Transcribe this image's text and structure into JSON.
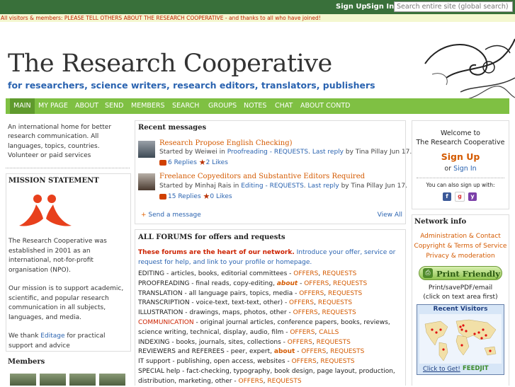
{
  "topbar": {
    "sign_up": "Sign Up",
    "sign_in": "Sign In",
    "search_placeholder": "Search entire site (global search)"
  },
  "notice": "All visitors & members: PLEASE TELL OTHERS ABOUT THE RESEARCH COOPERATIVE - and thanks to all who have joined!",
  "site": {
    "title": "The Research Cooperative",
    "subtitle": "for researchers, science writers, research editors, translators, publishers"
  },
  "nav": [
    "MAIN",
    "MY PAGE",
    "ABOUT",
    "SEND",
    "MEMBERS",
    "SEARCH",
    "GROUPS",
    "NOTES",
    "CHAT",
    "ABOUT CONTD"
  ],
  "left": {
    "intro": "An international home for better research communication. All languages, topics, countries. Volunteer or paid services",
    "mission_title": "MISSION STATEMENT",
    "mission_p1": "The Research Cooperative was established in 2001 as an international, not-for-profit organisation (NPO).",
    "mission_p2": "Our mission is to support academic, scientific, and popular research communication in all subjects, languages, and media.",
    "thanks_pre": "We thank ",
    "thanks_link": "Editage",
    "thanks_post": " for practical support and advice",
    "members_title": "Members"
  },
  "recent": {
    "title": "Recent messages",
    "messages": [
      {
        "title": "Research Propose   English Checking)",
        "started_by": "Started by ",
        "author": "Weiwei",
        "in": " in ",
        "forum": "Proofreading - REQUESTS",
        "last_reply": "Last reply",
        "by": " by Tina Pillay Jun 17.",
        "replies": "6 Replies",
        "likes": "2 Likes"
      },
      {
        "title": "Freelance Copyeditors and Substantive Editors Required",
        "started_by": "Started by ",
        "author": "Minhaj Rais",
        "in": " in ",
        "forum": "Editing - REQUESTS",
        "last_reply": "Last reply",
        "by": " by Tina Pillay Jun 17.",
        "replies": "15 Replies",
        "likes": "0 Likes"
      }
    ],
    "send": "Send a message",
    "view_all": "View All"
  },
  "forums": {
    "title": "ALL FORUMS for offers and requests",
    "intro_bold": "These forums are the heart of our network.",
    "intro_rest": " Introduce your offer, service or request for help, and link to your profile or homepage.",
    "lines": [
      {
        "text": "EDITING - articles, books, editorial committees - ",
        "about": "",
        "offers": "OFFERS",
        "requests": "REQUESTS"
      },
      {
        "text": "PROOFREADING - final reads, copy-editing, ",
        "about": "about",
        "offers": "OFFERS",
        "requests": "REQUESTS"
      },
      {
        "text": "TRANSLATION - all language pairs, topics, media - ",
        "about": "",
        "offers": "OFFERS",
        "requests": "REQUESTS"
      },
      {
        "text": "TRANSCRIPTION - voice-text, text-text, other) - ",
        "about": "",
        "offers": "OFFERS",
        "requests": "REQUESTS"
      },
      {
        "text": "ILLUSTRATION - drawings, maps, photos, other - ",
        "about": "",
        "offers": "OFFERS",
        "requests": "REQUESTS"
      }
    ],
    "communication_label": "COMMUNICATION",
    "communication_text": " - original journal articles, conference papers, books, reviews, science writing, technical, display, audio, film - ",
    "communication_offers": "OFFERS",
    "communication_calls": "CALLS",
    "lines2": [
      {
        "text": "INDEXING - books, journals, sites, collections - ",
        "about": "",
        "offers": "OFFERS",
        "requests": "REQUESTS"
      },
      {
        "text": "REVIEWERS and REFEREES - peer, expert, ",
        "about": "about",
        "offers": "OFFERS",
        "requests": "REQUESTS"
      },
      {
        "text": "IT support - publishing, open access, websites - ",
        "about": "",
        "offers": "OFFERS",
        "requests": "REQUESTS"
      }
    ],
    "special_text": "SPECIAL help - fact-checking, typography, book design, page layout, production, distribution, marketing, other - ",
    "special_offers": "OFFERS",
    "special_requests": "REQUESTS"
  },
  "welcome": {
    "line1": "Welcome to",
    "line2": "The Research Cooperative",
    "sign_up": "Sign Up",
    "or": "or ",
    "sign_in": "Sign In",
    "also": "You can also sign up with:"
  },
  "network": {
    "title": "Network info",
    "admin": "Administration & Contact",
    "copyright": "Copyright & Terms of Service",
    "privacy": "Privacy & moderation",
    "print": "Print Friendly",
    "print_note1": "Print/savePDF/email",
    "print_note2": "(click on text area first)",
    "visitors_title": "Recent Visitors",
    "click": "Click to Get!",
    "feedjit": "FEEDJIT"
  },
  "colors": {
    "brand_green": "#39703a",
    "nav_green": "#7fc043",
    "accent_orange": "#d45a00",
    "link_blue": "#2a63b0"
  }
}
